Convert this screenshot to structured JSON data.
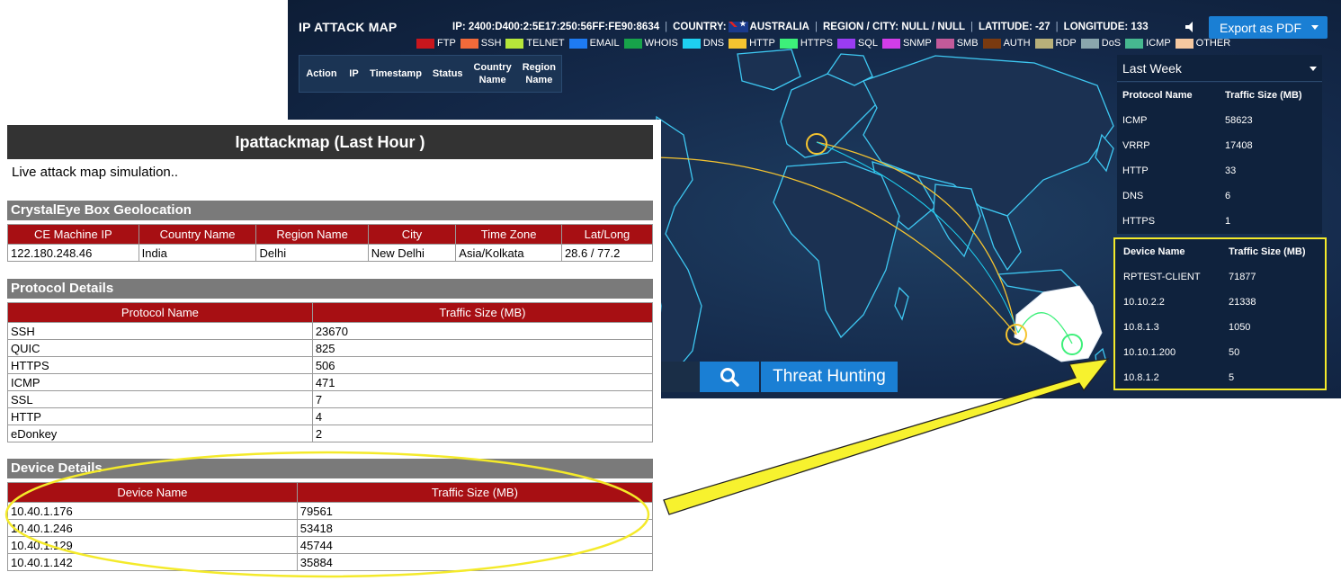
{
  "map": {
    "title": "IP ATTACK MAP",
    "info": {
      "ip": "IP: 2400:D400:2:5E17:250:56FF:FE90:8634",
      "country_label": "COUNTRY:",
      "country": "AUSTRALIA",
      "region": "REGION / CITY: NULL / NULL",
      "latitude": "LATITUDE: -27",
      "longitude": "LONGITUDE: 133"
    },
    "export_label": "Export as PDF",
    "legend": [
      {
        "label": "FTP",
        "color": "#c8161d"
      },
      {
        "label": "SSH",
        "color": "#f26a3a"
      },
      {
        "label": "TELNET",
        "color": "#b6e63a"
      },
      {
        "label": "EMAIL",
        "color": "#1e7bf2"
      },
      {
        "label": "WHOIS",
        "color": "#17a34a"
      },
      {
        "label": "DNS",
        "color": "#1ed0f0"
      },
      {
        "label": "HTTP",
        "color": "#f5c430"
      },
      {
        "label": "HTTPS",
        "color": "#3df07a"
      },
      {
        "label": "SQL",
        "color": "#9a3cf2"
      },
      {
        "label": "SNMP",
        "color": "#d23de8"
      },
      {
        "label": "SMB",
        "color": "#c35a9a"
      },
      {
        "label": "AUTH",
        "color": "#7a3a10"
      },
      {
        "label": "RDP",
        "color": "#b8b07a"
      },
      {
        "label": "DoS",
        "color": "#8aa6ad"
      },
      {
        "label": "ICMP",
        "color": "#46b890"
      },
      {
        "label": "OTHER",
        "color": "#f5c8a0"
      }
    ],
    "attack_table_headers": [
      "Action",
      "IP",
      "Timestamp",
      "Status",
      "Country Name",
      "Region Name"
    ],
    "period": "Last Week",
    "protocol_table": {
      "headers": [
        "Protocol Name",
        "Traffic Size (MB)"
      ],
      "rows": [
        [
          "ICMP",
          "58623"
        ],
        [
          "VRRP",
          "17408"
        ],
        [
          "HTTP",
          "33"
        ],
        [
          "DNS",
          "6"
        ],
        [
          "HTTPS",
          "1"
        ]
      ]
    },
    "device_table": {
      "headers": [
        "Device Name",
        "Traffic Size (MB)"
      ],
      "rows": [
        [
          "RPTEST-CLIENT",
          "71877"
        ],
        [
          "10.10.2.2",
          "21338"
        ],
        [
          "10.8.1.3",
          "1050"
        ],
        [
          "10.10.1.200",
          "50"
        ],
        [
          "10.8.1.2",
          "5"
        ]
      ]
    },
    "threat_hunting_label": "Threat Hunting"
  },
  "report": {
    "title": "Ipattackmap (Last Hour )",
    "subtitle": "Live attack map simulation..",
    "geo_section": "CrystalEye Box Geolocation",
    "geo_headers": [
      "CE Machine IP",
      "Country Name",
      "Region Name",
      "City",
      "Time Zone",
      "Lat/Long"
    ],
    "geo_row": [
      "122.180.248.46",
      "India",
      "Delhi",
      "New Delhi",
      "Asia/Kolkata",
      "28.6 / 77.2"
    ],
    "protocol_section": "Protocol Details",
    "protocol_headers": [
      "Protocol Name",
      "Traffic Size (MB)"
    ],
    "protocol_rows": [
      [
        "SSH",
        "23670"
      ],
      [
        "QUIC",
        "825"
      ],
      [
        "HTTPS",
        "506"
      ],
      [
        "ICMP",
        "471"
      ],
      [
        "SSL",
        "7"
      ],
      [
        "HTTP",
        "4"
      ],
      [
        "eDonkey",
        "2"
      ]
    ],
    "device_section": "Device Details",
    "device_headers": [
      "Device Name",
      "Traffic Size (MB)"
    ],
    "device_rows": [
      [
        "10.40.1.176",
        "79561"
      ],
      [
        "10.40.1.246",
        "53418"
      ],
      [
        "10.40.1.129",
        "45744"
      ],
      [
        "10.40.1.142",
        "35884"
      ]
    ]
  },
  "colors": {
    "header_red": "#a70f13",
    "highlight_yellow": "#f4ea2a",
    "button_blue": "#1a7fd4"
  }
}
